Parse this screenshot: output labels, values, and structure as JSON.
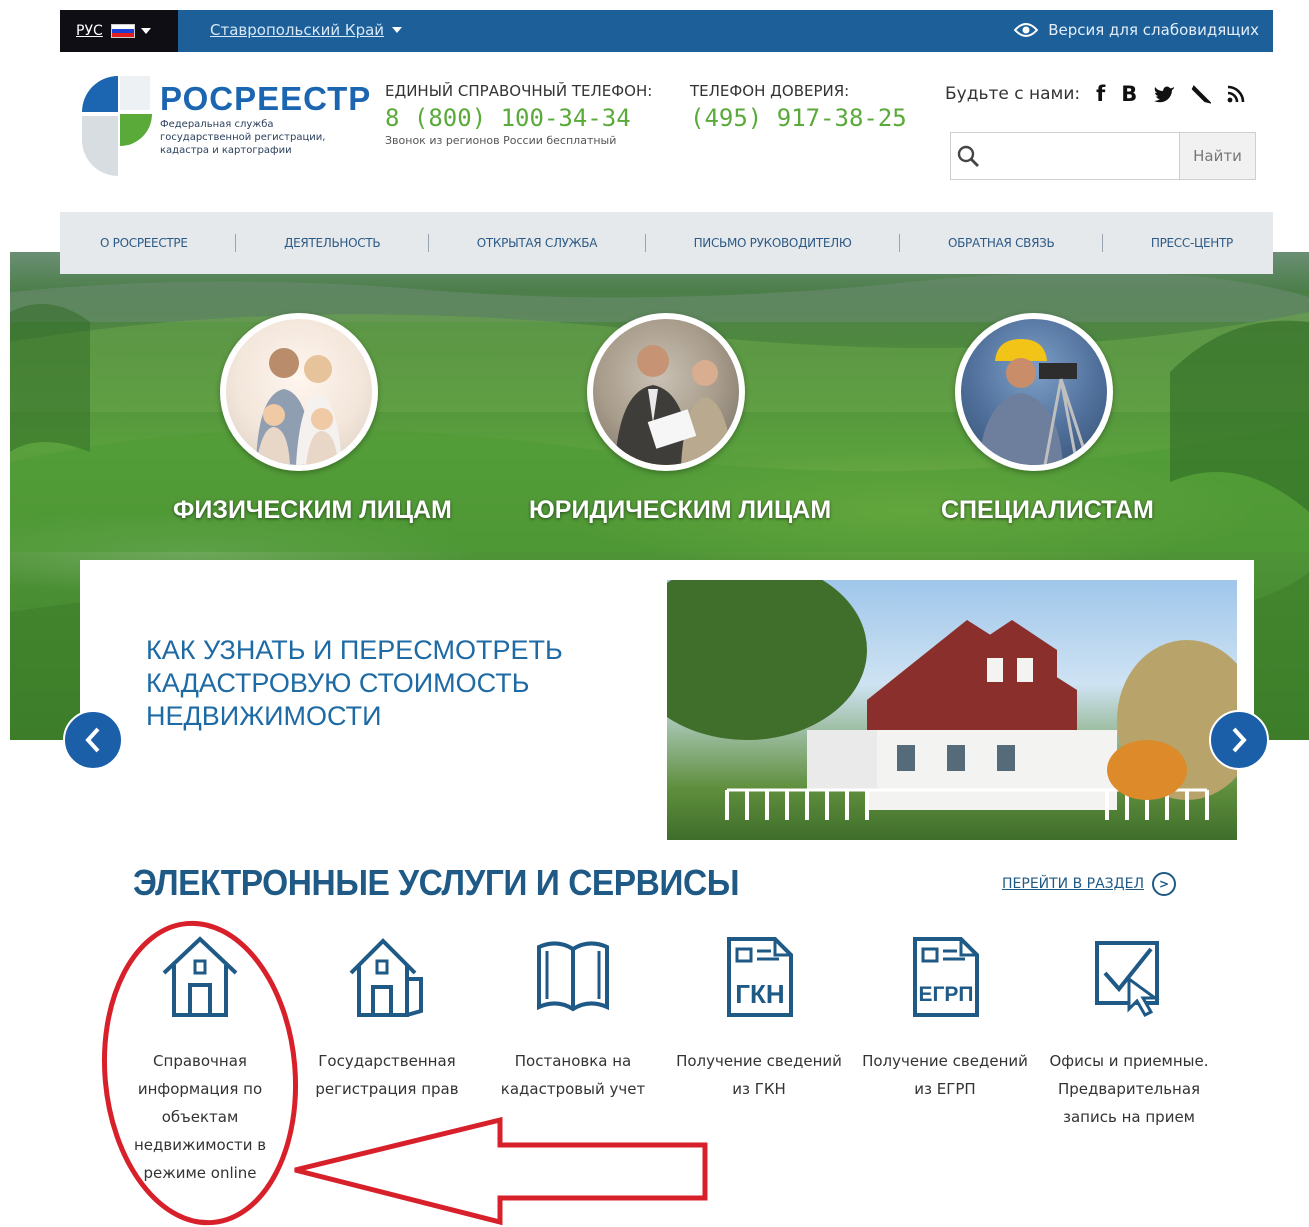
{
  "topbar": {
    "lang": "РУС",
    "region": "Ставропольский Край",
    "low_vision": "Версия для слабовидящих"
  },
  "header": {
    "logo_title": "РОСРЕЕСТР",
    "logo_subtitle": "Федеральная служба государственной регистрации, кадастра и картографии",
    "phone1_label": "ЕДИНЫЙ СПРАВОЧНЫЙ ТЕЛЕФОН:",
    "phone1_number": "8 (800) 100-34-34",
    "phone1_note": "Звонок из регионов России бесплатный",
    "phone2_label": "ТЕЛЕФОН ДОВЕРИЯ:",
    "phone2_number": "(495) 917-38-25",
    "social_label": "Будьте с нами:",
    "social_icons": [
      "facebook-icon",
      "vk-icon",
      "twitter-icon",
      "livejournal-icon",
      "rss-icon"
    ],
    "search_placeholder": "",
    "search_button": "Найти"
  },
  "nav": {
    "items": [
      "О РОСРЕЕСТРЕ",
      "ДЕЯТЕЛЬНОСТЬ",
      "ОТКРЫТАЯ СЛУЖБА",
      "ПИСЬМО РУКОВОДИТЕЛЮ",
      "ОБРАТНАЯ СВЯЗЬ",
      "ПРЕСС-ЦЕНТР"
    ]
  },
  "audiences": [
    "ФИЗИЧЕСКИМ ЛИЦАМ",
    "ЮРИДИЧЕСКИМ ЛИЦАМ",
    "СПЕЦИАЛИСТАМ"
  ],
  "slider": {
    "title": "КАК УЗНАТЬ И ПЕРЕСМОТРЕТЬ КАДАСТРОВУЮ СТОИМОСТЬ НЕДВИЖИМОСТИ"
  },
  "services": {
    "title": "ЭЛЕКТРОННЫЕ УСЛУГИ И СЕРВИСЫ",
    "goto_label": "ПЕРЕЙТИ В РАЗДЕЛ",
    "items": [
      "Справочная информация по объектам недвижимости в режиме online",
      "Государственная регистрация прав",
      "Постановка на кадастровый учет",
      "Получение сведений из ГКН",
      "Получение сведений из ЕГРП",
      "Офисы и приемные. Предварительная запись на прием"
    ],
    "icon_texts": [
      "ГКН",
      "ЕГРП"
    ]
  },
  "colors": {
    "brand_blue": "#1c65b0",
    "topbar": "#1c5f99",
    "phone_green": "#5aaa3a",
    "annotation_red": "#d8202a"
  }
}
